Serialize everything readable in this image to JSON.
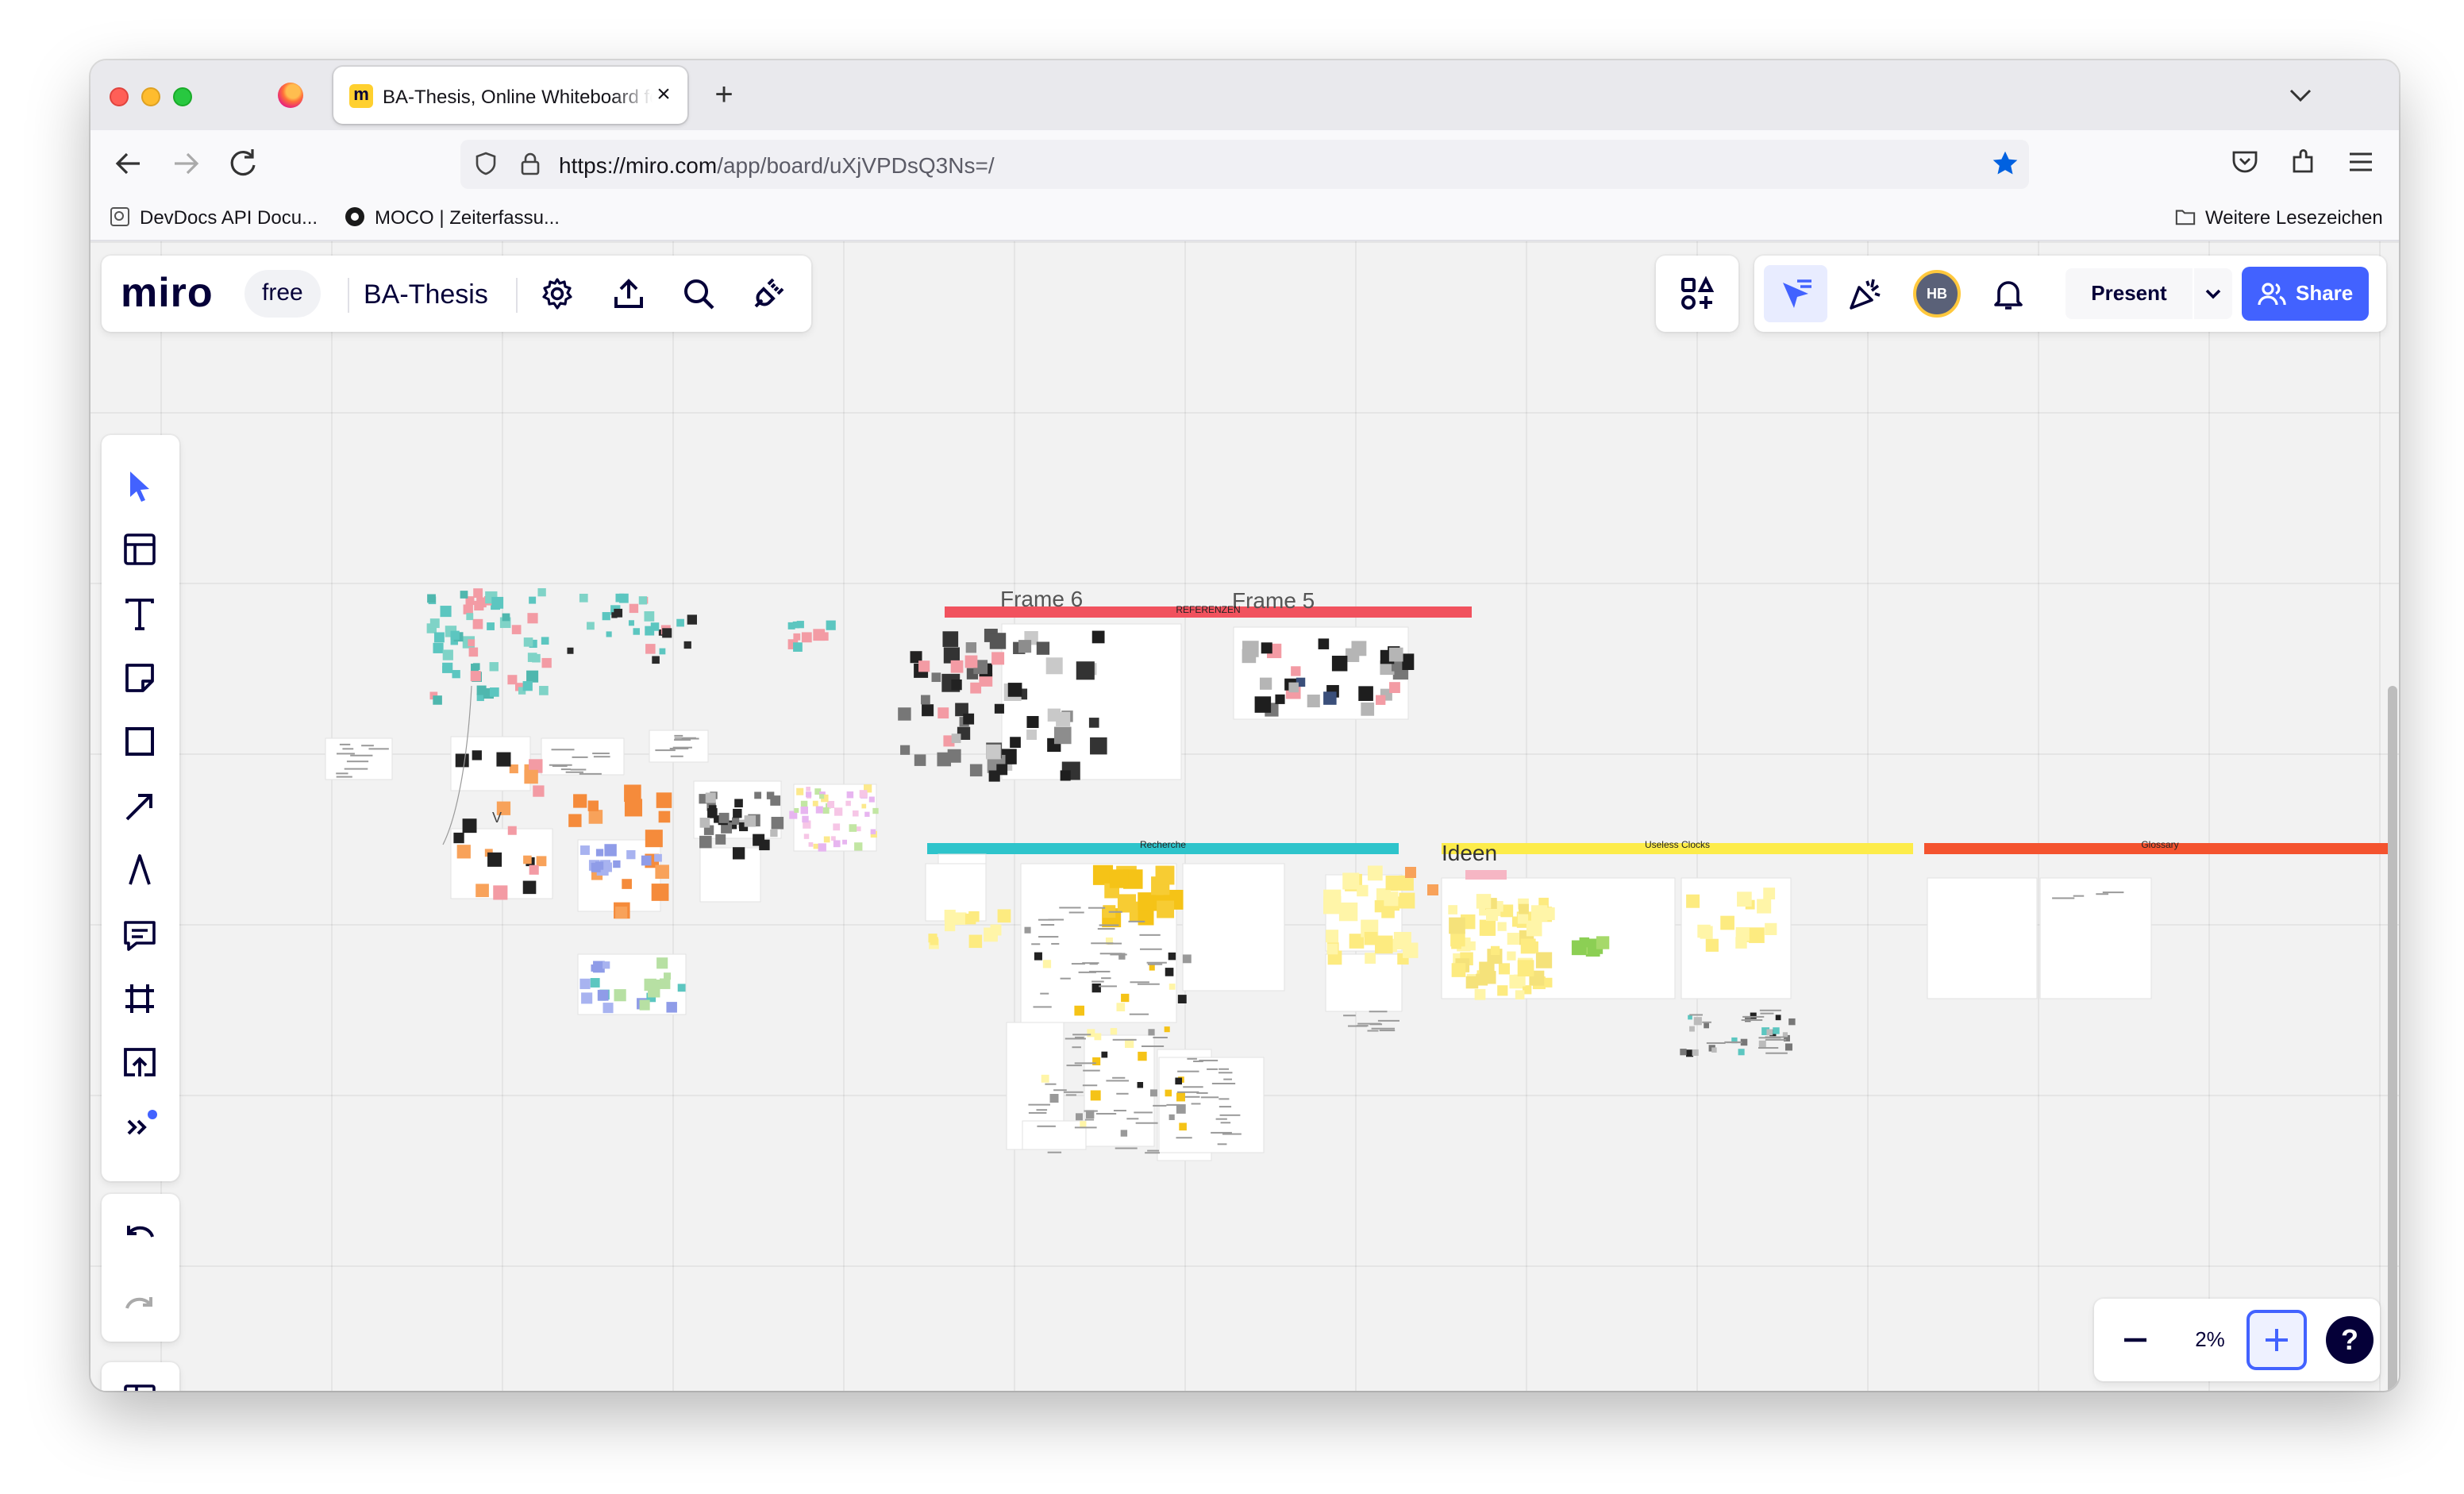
{
  "browser": {
    "tab_title": "BA-Thesis, Online Whiteboard for Visual Collaboration",
    "tab_favicon": "m",
    "tab_close": "×",
    "new_tab": "+",
    "url_domain": "https://miro.com",
    "url_path": "/app/board/uXjVPDsQ3Ns=/",
    "bookmarks": [
      {
        "label": "DevDocs API Docu...",
        "icon": "page-icon"
      },
      {
        "label": "MOCO | Zeiterfassu...",
        "icon": "moco-icon"
      }
    ],
    "other_bookmarks": "Weitere Lesezeichen"
  },
  "miro": {
    "logo": "miro",
    "plan": "free",
    "board_name": "BA-Thesis",
    "present_label": "Present",
    "share_label": "Share",
    "avatar_initials": "HB",
    "zoom": "2%",
    "help": "?",
    "accent_color": "#4262ff"
  },
  "canvas": {
    "frames": [
      "Frame 6",
      "Frame 5",
      "Ideen"
    ],
    "section_bands": [
      {
        "label": "REFERENZEN",
        "color": "#f1525e"
      },
      {
        "label": "Recherche",
        "color": "#2ec4cb"
      },
      {
        "label": "Useless Clocks",
        "color": "#fdec4a"
      },
      {
        "label": "Glossary",
        "color": "#f4532f"
      }
    ],
    "stray_label": "V"
  }
}
